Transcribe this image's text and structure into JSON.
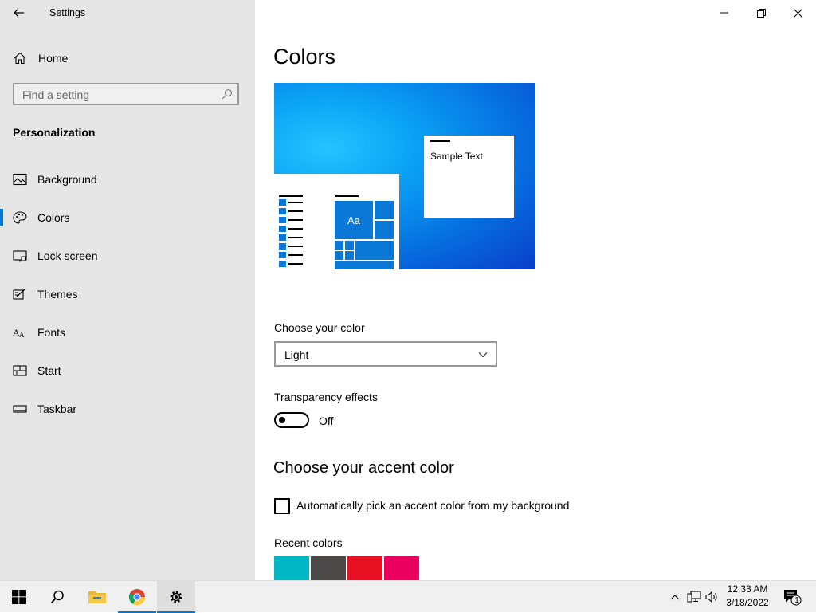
{
  "window": {
    "app_title": "Settings",
    "controls": {
      "minimize": "minimize-icon",
      "restore": "restore-icon",
      "close": "close-icon"
    }
  },
  "sidebar": {
    "home_label": "Home",
    "search_placeholder": "Find a setting",
    "section_title": "Personalization",
    "items": [
      {
        "label": "Background",
        "icon": "picture-icon"
      },
      {
        "label": "Colors",
        "icon": "palette-icon",
        "active": true
      },
      {
        "label": "Lock screen",
        "icon": "lock-screen-icon"
      },
      {
        "label": "Themes",
        "icon": "themes-icon"
      },
      {
        "label": "Fonts",
        "icon": "fonts-icon"
      },
      {
        "label": "Start",
        "icon": "start-icon"
      },
      {
        "label": "Taskbar",
        "icon": "taskbar-icon"
      }
    ]
  },
  "main": {
    "page_title": "Colors",
    "preview": {
      "sample_text": "Sample Text",
      "tile_text": "Aa"
    },
    "choose_color": {
      "label": "Choose your color",
      "selected": "Light"
    },
    "transparency": {
      "label": "Transparency effects",
      "state": "Off"
    },
    "accent": {
      "heading": "Choose your accent color",
      "auto_pick_label": "Automatically pick an accent color from my background",
      "recent_label": "Recent colors",
      "recent_colors": [
        "#00b7c3",
        "#4c4a48",
        "#e81123",
        "#ea005e"
      ]
    }
  },
  "taskbar": {
    "apps": [
      "start-icon",
      "search-icon",
      "file-explorer-icon",
      "chrome-icon",
      "settings-icon"
    ],
    "clock_time": "12:33 AM",
    "clock_date": "3/18/2022",
    "notification_count": "1"
  },
  "colors": {
    "accent": "#0078d7",
    "sidebar_bg": "#e6e6e6",
    "taskbar_bg": "#f0f0f0"
  }
}
